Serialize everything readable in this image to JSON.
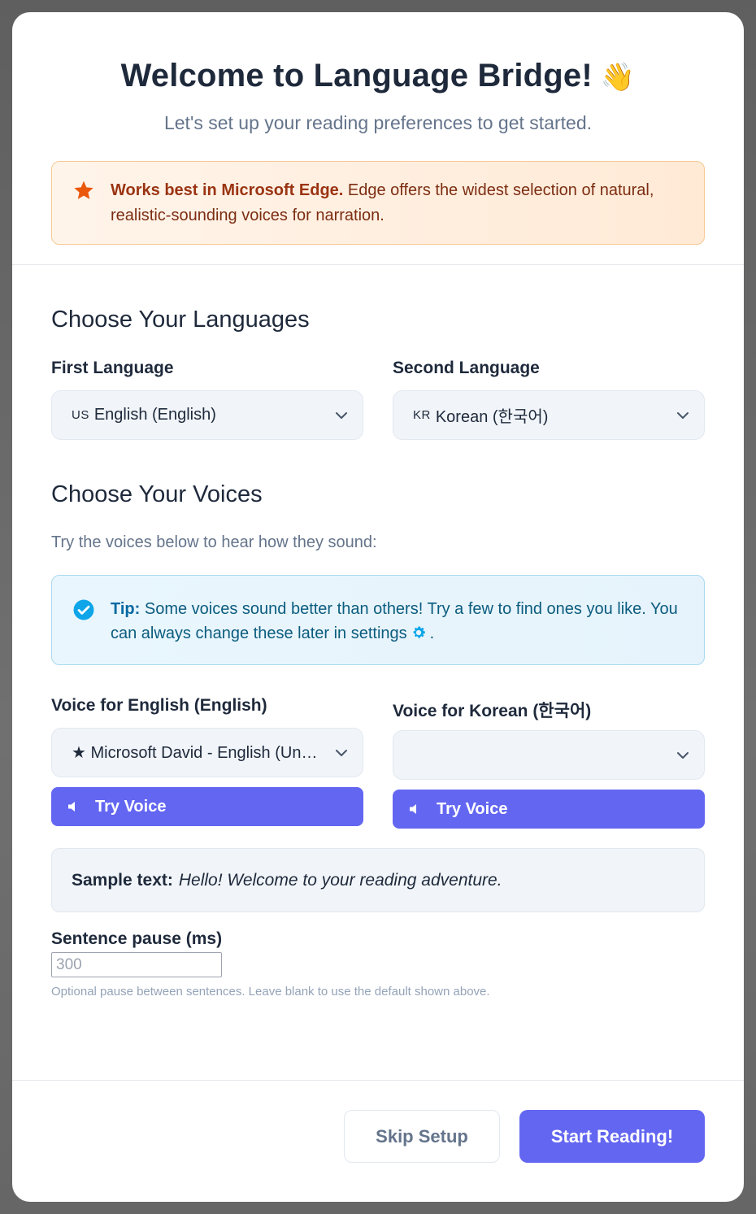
{
  "header": {
    "title": "Welcome to Language Bridge!",
    "title_emoji": "👋",
    "subtitle": "Let's set up your reading preferences to get started."
  },
  "notice": {
    "icon": "star-icon",
    "bold": "Works best in Microsoft Edge.",
    "text": " Edge offers the widest selection of natural, realistic-sounding voices for narration."
  },
  "languages": {
    "section_title": "Choose Your Languages",
    "first_label": "First Language",
    "first_flag": "US",
    "first_value": "English (English)",
    "second_label": "Second Language",
    "second_flag": "KR",
    "second_value": "Korean (한국어)"
  },
  "voices": {
    "section_title": "Choose Your Voices",
    "helper": "Try the voices below to hear how they sound:",
    "tip_bold": "Tip:",
    "tip_text_1": " Some voices sound better than others! Try a few to find ones you like. You can always change these later in settings",
    "tip_text_2": ".",
    "tip_icon": "check-circle-icon",
    "settings_icon": "gear-icon",
    "english_label": "Voice for English (English)",
    "english_value": "★ Microsoft David - English (United States)",
    "korean_label": "Voice for Korean (한국어)",
    "korean_value": "",
    "try_label": "Try Voice",
    "sample_bold": "Sample text:",
    "sample_text": "Hello! Welcome to your reading adventure."
  },
  "pause": {
    "label": "Sentence pause (ms)",
    "placeholder": "300",
    "value": "",
    "hint": "Optional pause between sentences. Leave blank to use the default shown above."
  },
  "footer": {
    "skip_label": "Skip Setup",
    "start_label": "Start Reading!"
  },
  "colors": {
    "accent": "#6366f1",
    "notice_text": "#9a3412",
    "tip_text": "#0369a1"
  }
}
